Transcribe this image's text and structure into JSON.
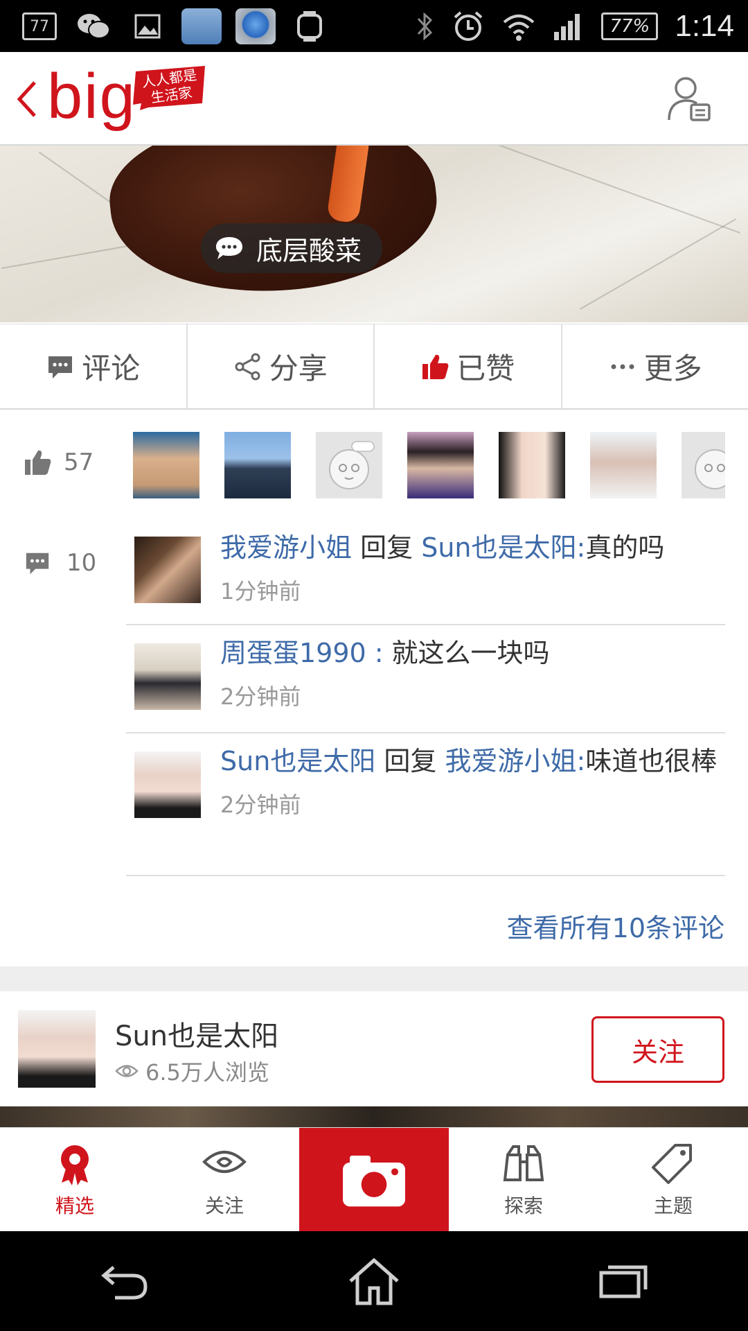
{
  "status_bar": {
    "badge_number": "77",
    "battery": "77%",
    "time": "1:14"
  },
  "header": {
    "logo_text": "big",
    "tagline": "人人都是生活家"
  },
  "hero": {
    "tag_label": "底层酸菜"
  },
  "actions": [
    {
      "label": "评论",
      "icon": "comment-icon"
    },
    {
      "label": "分享",
      "icon": "share-icon"
    },
    {
      "label": "已赞",
      "icon": "thumb-up-icon"
    },
    {
      "label": "更多",
      "icon": "more-icon"
    }
  ],
  "likes": {
    "count": "57",
    "avatar_count": 7
  },
  "comments_section": {
    "count": "10",
    "items": [
      {
        "user": "我爱游小姐",
        "reply_word": "回复",
        "reply_to": "Sun也是太阳",
        "sep": ":",
        "text": "真的吗",
        "time": "1分钟前"
      },
      {
        "user": "周蛋蛋1990",
        "reply_word": "",
        "reply_to": "",
        "sep": ":",
        "text": "就这么一块吗",
        "time": "2分钟前"
      },
      {
        "user": "Sun也是太阳",
        "reply_word": "回复",
        "reply_to": "我爱游小姐",
        "sep": ":",
        "text": "味道也很棒",
        "time": "2分钟前"
      }
    ],
    "view_all": "查看所有10条评论"
  },
  "author": {
    "name": "Sun也是太阳",
    "views": "6.5万人浏览",
    "follow_label": "关注"
  },
  "bottom_nav": [
    {
      "label": "精选",
      "icon": "badge-icon",
      "active": true
    },
    {
      "label": "关注",
      "icon": "eye-icon",
      "active": false
    },
    {
      "label": "",
      "icon": "camera-icon",
      "active": false
    },
    {
      "label": "探索",
      "icon": "binoculars-icon",
      "active": false
    },
    {
      "label": "主题",
      "icon": "tag-icon",
      "active": false
    }
  ],
  "colors": {
    "accent": "#d0141c",
    "link": "#3e6aa8"
  }
}
